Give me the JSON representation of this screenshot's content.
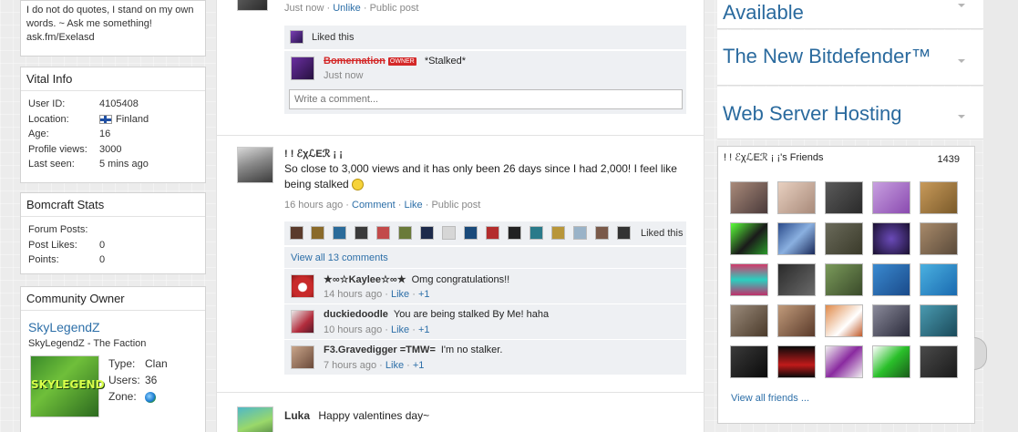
{
  "about": {
    "text": "I do not do quotes, I stand on my own words. ~ Ask me something! ask.fm/Exelasd"
  },
  "vital_info": {
    "title": "Vital Info",
    "rows": [
      {
        "label": "User ID:",
        "value": "4105408"
      },
      {
        "label": "Location:",
        "value": "Finland"
      },
      {
        "label": "Age:",
        "value": "16"
      },
      {
        "label": "Profile views:",
        "value": "3000"
      },
      {
        "label": "Last seen:",
        "value": "5 mins ago"
      }
    ]
  },
  "bomcraft_stats": {
    "title": "Bomcraft Stats",
    "rows": [
      {
        "label": "Forum Posts:",
        "value": ""
      },
      {
        "label": "Post Likes:",
        "value": "0"
      },
      {
        "label": "Points:",
        "value": "0"
      }
    ]
  },
  "community": {
    "title": "Community Owner",
    "owner_link": "SkyLegendZ",
    "owner_sub": "SkyLegendZ - The Faction",
    "image_text": "SKYLEGEND",
    "type_label": "Type:",
    "type_value": "Clan",
    "users_label": "Users:",
    "users_value": "36",
    "zone_label": "Zone:"
  },
  "post1": {
    "time": "Just now",
    "unlike": "Unlike",
    "visibility": "Public post",
    "liked_this": "Liked this",
    "comment_author": "Bomernation",
    "owner_tag": "OWNER",
    "comment_text": "*Stalked*",
    "comment_time": "Just now",
    "comment_placeholder": "Write a comment..."
  },
  "post2": {
    "author": "! ! ℰχℒΕℛ ¡ ¡",
    "text": "So close to 3,000 views and it has only been 26 days since I had 2,000! I feel like being stalked",
    "time": "16 hours ago",
    "comment": "Comment",
    "like": "Like",
    "visibility": "Public post",
    "liked_this": "Liked this",
    "view_all": "View all 13 comments",
    "comments": [
      {
        "name": "★∞☆Kaylee☆∞★",
        "text": "Omg congratulations!!",
        "time": "14 hours ago",
        "like": "Like",
        "plus": "+1"
      },
      {
        "name": "duckiedoodle",
        "text": "You are being stalked By Me! haha",
        "time": "10 hours ago",
        "like": "Like",
        "plus": "+1"
      },
      {
        "name": "F3.Gravedigger =TMW=",
        "text": "I'm no stalker.",
        "time": "7 hours ago",
        "like": "Like",
        "plus": "+1"
      }
    ]
  },
  "post3": {
    "author": "Luka",
    "text": "Happy valentines day~"
  },
  "ads": [
    {
      "title": "Available"
    },
    {
      "title": "The New Bitdefender™"
    },
    {
      "title": "Web Server Hosting"
    }
  ],
  "friends": {
    "title": "! ! ℰχℒΕℛ ¡ ¡'s Friends",
    "count": "1439",
    "view_all": "View all friends ..."
  },
  "colors": {
    "link": "#2d6fa8",
    "ad_title": "#2a6a9e",
    "owner_tag": "#d42828"
  }
}
